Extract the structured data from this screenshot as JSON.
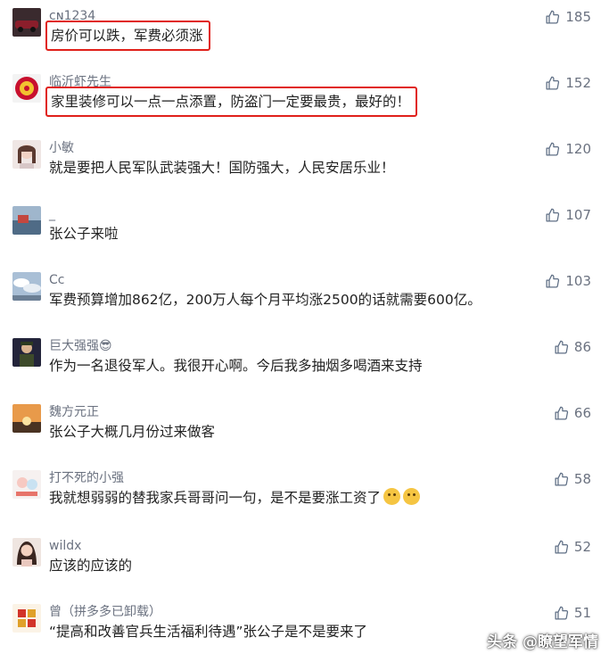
{
  "comments": [
    {
      "user": "ᴄɴ1234",
      "text": "房价可以跌，军费必须涨",
      "likes": "185",
      "highlight": true,
      "avatar": "car"
    },
    {
      "user": "临沂虾先生",
      "text": "家里装修可以一点一点添置，防盗门一定要最贵，最好的！",
      "likes": "152",
      "highlight": true,
      "avatar": "emblem"
    },
    {
      "user": "小敏",
      "text": "就是要把人民军队武装强大！国防强大，人民安居乐业！",
      "likes": "120",
      "highlight": false,
      "avatar": "girl"
    },
    {
      "user": "_",
      "text": "张公子来啦",
      "likes": "107",
      "highlight": false,
      "avatar": "sea"
    },
    {
      "user": "Cc",
      "text": "军费预算增加862亿，200万人每个月平均涨2500的话就需要600亿。",
      "likes": "103",
      "highlight": false,
      "avatar": "clouds"
    },
    {
      "user": "巨大强强😎",
      "text": "作为一名退役军人。我很开心啊。今后我多抽烟多喝酒来支持",
      "likes": "86",
      "highlight": false,
      "avatar": "soldier"
    },
    {
      "user": "魏方元正",
      "text": "张公子大概几月份过来做客",
      "likes": "66",
      "highlight": false,
      "avatar": "sunset"
    },
    {
      "user": "打不死的小强",
      "text": "我就想弱弱的替我家兵哥哥问一句，是不是要涨工资了",
      "likes": "58",
      "highlight": false,
      "avatar": "cartoon",
      "emoji_count": 2
    },
    {
      "user": "wildx",
      "text": "应该的应该的",
      "likes": "52",
      "highlight": false,
      "avatar": "woman"
    },
    {
      "user": "曾（拼多多已卸载）",
      "text": "“提高和改善官兵生活福利待遇”张公子是不是要来了",
      "likes": "51",
      "highlight": false,
      "avatar": "logo"
    }
  ],
  "icons": {
    "like": "thumbs-up-icon"
  },
  "watermark": "头条 @瞭望军情",
  "colors": {
    "highlight_border": "#e0201a",
    "username": "#6b7280",
    "text": "#222222"
  }
}
